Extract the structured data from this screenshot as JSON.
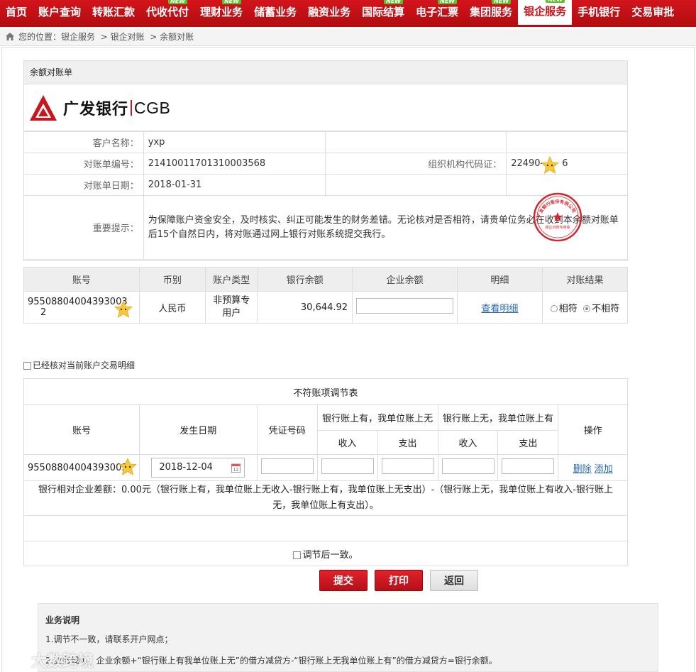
{
  "nav": {
    "items": [
      {
        "label": "首页",
        "new": false
      },
      {
        "label": "账户查询",
        "new": false
      },
      {
        "label": "转账汇款",
        "new": false
      },
      {
        "label": "代收代付",
        "new": true
      },
      {
        "label": "理财业务",
        "new": true
      },
      {
        "label": "储蓄业务",
        "new": false
      },
      {
        "label": "融资业务",
        "new": false
      },
      {
        "label": "国际结算",
        "new": true
      },
      {
        "label": "电子汇票",
        "new": true
      },
      {
        "label": "集团服务",
        "new": true
      },
      {
        "label": "银企服务",
        "new": true,
        "active": true
      },
      {
        "label": "手机银行",
        "new": false
      },
      {
        "label": "交易审批",
        "new": false
      }
    ],
    "new_badge": "NEW"
  },
  "breadcrumb": {
    "prefix": "您的位置：",
    "items": [
      "银企服务",
      "银企对账",
      "余额对账"
    ],
    "sep": ">"
  },
  "panel": {
    "title": "余额对账单"
  },
  "logo": {
    "cn": "广发银行",
    "en": "CGB"
  },
  "info": {
    "customer_label": "客户名称：",
    "customer_value": "yxp",
    "statement_no_label": "对账单编号：",
    "statement_no_value": "21410011701310003568",
    "org_code_label": "组织机构代码证：",
    "org_code_value": "22490-",
    "org_code_tail": "6",
    "statement_date_label": "对账单日期：",
    "statement_date_value": "2018-01-31",
    "notice_label": "重要提示：",
    "notice_text": "为保障账户资金安全，及时核实、纠正可能发生的财务差错。无论核对是否相符，请贵单位务必在收到本余额对账单后15个自然日内，将对账通过网上银行对账系统提交我行。",
    "seal_text": "广发银行股份有限公司",
    "seal_sub": "银企对账专用章"
  },
  "account_table": {
    "headers": [
      "账号",
      "币别",
      "账户类型",
      "银行余额",
      "企业余额",
      "明细",
      "对账结果"
    ],
    "row": {
      "account": "95508804004393003",
      "account_tail": "2",
      "currency": "人民币",
      "type": "非预算专用户",
      "bank_balance": "30,644.92",
      "detail_link": "查看明细",
      "match": "相符",
      "mismatch": "不相符"
    }
  },
  "checked_detail_label": "已经核对当前账户交易明细",
  "adjust": {
    "title": "不符账项调节表",
    "h_account": "账号",
    "h_date": "发生日期",
    "h_voucher": "凭证号码",
    "h_bank_only": "银行账上有，我单位账上无",
    "h_corp_only": "银行账上无，我单位账上有",
    "h_op": "操作",
    "h_income": "收入",
    "h_expense": "支出",
    "row_account": "95508804004393003",
    "row_date": "2018-12-04",
    "delete": "删除",
    "add": "添加",
    "diff_text": "银行相对企业差额：0.00元（银行账上有，我单位账上无收入-银行账上有，我单位账上无支出）-（银行账上无，我单位账上有收入-银行账上无，我单位账上有支出）。",
    "consistent_label": "调节后一致。"
  },
  "buttons": {
    "submit": "提交",
    "print": "打印",
    "back": "返回"
  },
  "desc": {
    "title": "业务说明",
    "line1": "1.调节不一致，请联系开户网点；",
    "line2": "2.业务规则：企业余额+“银行账上有我单位账上无”的借方减贷方-“银行账上无我单位账上有”的借方减贷方=银行余额。"
  },
  "watermark": "大数跨境",
  "colors": {
    "brand_red": "#c8161d",
    "new_green": "#5bbf2a",
    "link_blue": "#2a6ab5"
  }
}
